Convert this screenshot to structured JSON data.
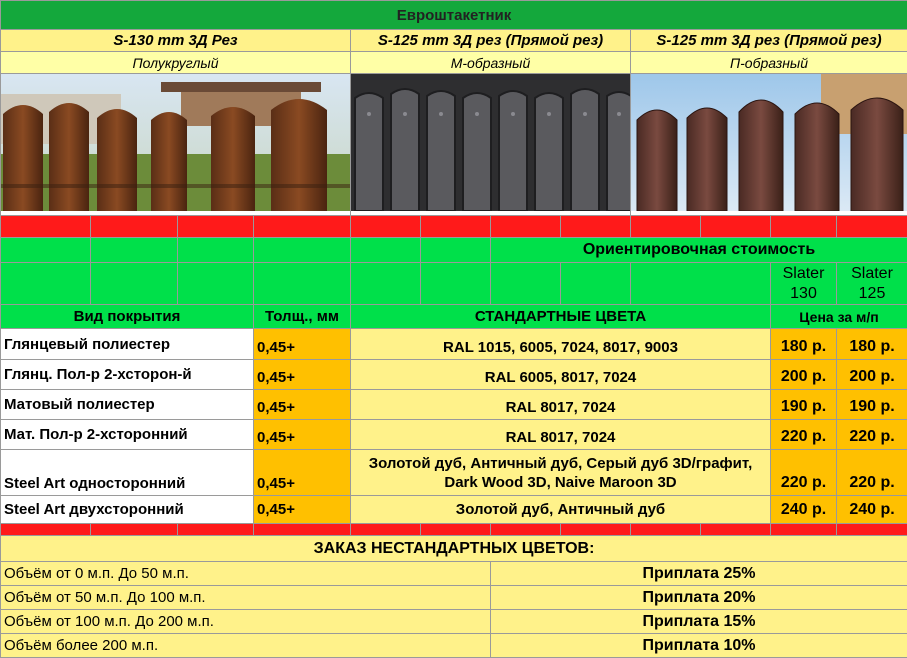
{
  "title": "Евроштакетник",
  "products": [
    {
      "model": "S-130 mm 3Д Рез",
      "shape": "Полукруглый",
      "photo_icon": "semicircle-picket-fence-photo"
    },
    {
      "model": "S-125 mm 3Д рез (Прямой рез)",
      "shape": "М-образный",
      "photo_icon": "m-shaped-picket-fence-photo"
    },
    {
      "model": "S-125 mm 3Д рез (Прямой рез)",
      "shape": "П-образный",
      "photo_icon": "p-shaped-picket-fence-photo"
    }
  ],
  "price_header": {
    "approx_cost": "Ориентировочная стоимость",
    "col_slater130": "Slater 130",
    "col_slater125": "Slater 125"
  },
  "table_header": {
    "coating": "Вид покрытия",
    "thickness": "Толщ., мм",
    "colors": "СТАНДАРТНЫЕ ЦВЕТА",
    "price_per_m": "Цена за м/п"
  },
  "rows": [
    {
      "coating": "Глянцевый полиестер",
      "thickness": "0,45+",
      "colors": "RAL 1015, 6005, 7024, 8017, 9003",
      "p130": "180 р.",
      "p125": "180 р."
    },
    {
      "coating": "Глянц. Пол-р 2-хсторон-й",
      "thickness": "0,45+",
      "colors": "RAL 6005, 8017, 7024",
      "p130": "200 р.",
      "p125": "200 р."
    },
    {
      "coating": "Матовый полиестер",
      "thickness": "0,45+",
      "colors": "RAL 8017, 7024",
      "p130": "190 р.",
      "p125": "190 р."
    },
    {
      "coating": "Мат. Пол-р 2-хсторонний",
      "thickness": "0,45+",
      "colors": "RAL 8017, 7024",
      "p130": "220 р.",
      "p125": "220 р."
    },
    {
      "coating": "Steel Art односторонний",
      "thickness": "0,45+",
      "colors": "Золотой дуб, Античный дуб, Серый дуб 3D/графит, Dark Wood 3D, Naive Maroon 3D",
      "p130": "220 р.",
      "p125": "220 р."
    },
    {
      "coating": "Steel Art двухсторонний",
      "thickness": "0,45+",
      "colors": "Золотой дуб, Античный дуб",
      "p130": "240 р.",
      "p125": "240 р."
    }
  ],
  "nonstandard": {
    "title": "ЗАКАЗ НЕСТАНДАРТНЫХ ЦВЕТОВ:",
    "rows": [
      {
        "volume": "Объём от 0 м.п. До 50 м.п.",
        "surcharge": "Приплата 25%"
      },
      {
        "volume": "Объём от 50 м.п. До 100 м.п.",
        "surcharge": "Приплата 20%"
      },
      {
        "volume": "Объём от 100 м.п. До 200 м.п.",
        "surcharge": "Приплата 15%"
      },
      {
        "volume": "Объём более 200 м.п.",
        "surcharge": "Приплата 10%"
      }
    ]
  },
  "colors": {
    "green": "#00e04a",
    "dark_green": "#14a83c",
    "yellow": "#fff28a",
    "orange": "#ffc000",
    "red": "#ff1a1a"
  }
}
